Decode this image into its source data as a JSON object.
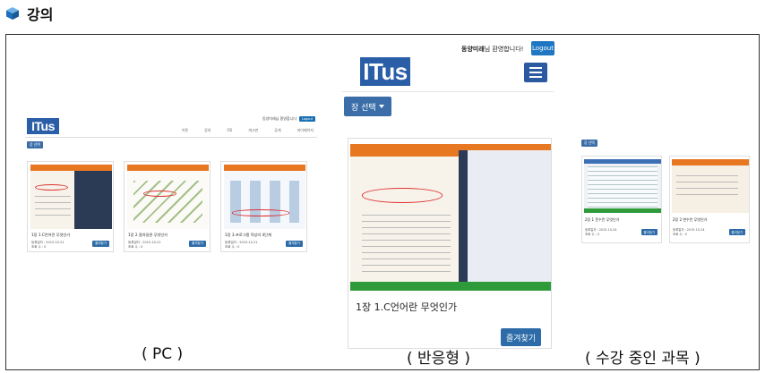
{
  "heading": {
    "title": "강의"
  },
  "pc": {
    "logo": "ITus",
    "greeting": "동양미래님 환영합니다",
    "logout": "Logout",
    "nav": [
      "이론",
      "강의",
      "OS",
      "게시판",
      "공개",
      "마이페이지"
    ],
    "select": "장 선택",
    "courses": [
      {
        "title": "1장 1.C언어란 무엇인가",
        "date_label": "등록일자 : 2015-10-21",
        "views_label": "조회 수 : 0",
        "button": "즐겨찾기"
      },
      {
        "title": "1장 2.절차일관 무엇인가",
        "date_label": "등록일자 : 2015-10-21",
        "views_label": "조회 수 : 0",
        "button": "즐겨찾기"
      },
      {
        "title": "1장 3.프로그램 작성의 4단계",
        "date_label": "등록일자 : 2015-10-21",
        "views_label": "조회 수 : 0",
        "button": "즐겨찾기"
      }
    ]
  },
  "responsive": {
    "user_name": "동양미래",
    "greeting_suffix": "님 환영합니다!",
    "logout": "Logout",
    "logo": "ITus",
    "select": "장 선택",
    "course": {
      "title": "1장 1.C언어란 무엇인가",
      "button": "즐겨찾기"
    }
  },
  "taking": {
    "select": "장 선택",
    "courses": [
      {
        "title": "2장 1 문수란 무엇인가",
        "date_label": "등록일자 : 2015-10-24",
        "views_label": "조회 수 : 0",
        "button": "즐겨찾기"
      },
      {
        "title": "2장 2 변수란 무엇인가",
        "date_label": "등록일자 : 2015-10-24",
        "views_label": "조회 수 : 0",
        "button": "즐겨찾기"
      }
    ]
  },
  "captions": {
    "pc": "( PC )",
    "responsive": "( 반응형 )",
    "taking": "( 수강 중인 과목 )"
  },
  "colors": {
    "brand_blue": "#2a5fa8",
    "button_blue": "#2d6ca8",
    "accent_orange": "#e87722"
  }
}
